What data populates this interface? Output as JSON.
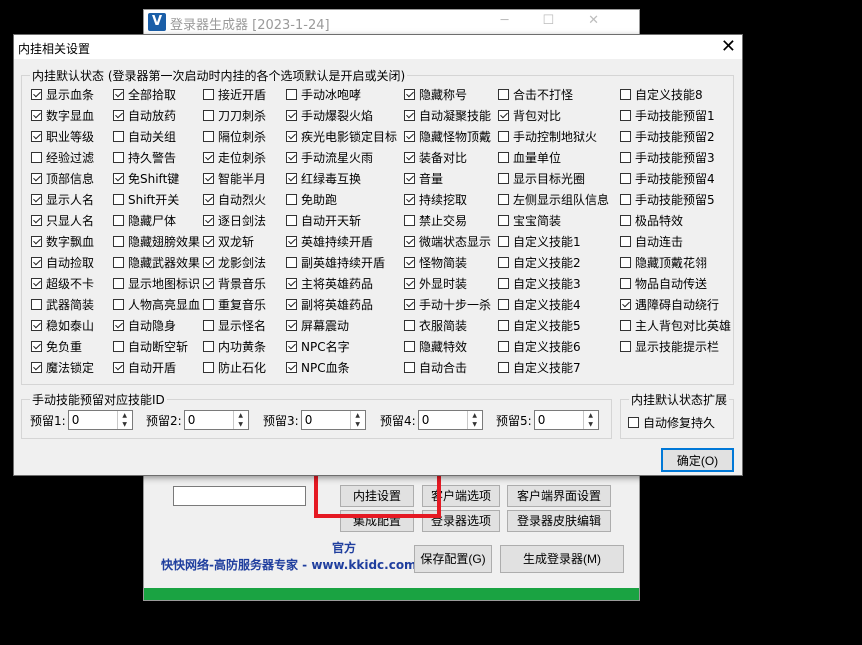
{
  "main_window": {
    "title": "登录器生成器 [2023-1-24]",
    "app_icon_letter": "V",
    "buttons": {
      "plugin_settings": "内挂设置",
      "client_options": "客户端选项",
      "client_ui_settings": "客户端界面设置",
      "collect_config": "集成配置",
      "launcher_options": "登录器选项",
      "launcher_skin": "登录器皮肤编辑",
      "save_config": "保存配置(G)",
      "generate": "生成登录器(M)"
    },
    "official_label": "官方",
    "website": "快快网络-高防服务器专家 - www.kkidc.com"
  },
  "dialog": {
    "title": "内挂相关设置",
    "close_glyph": "✕",
    "defaults_group": "内挂默认状态 (登录器第一次启动时内挂的各个选项默认是开启或关闭)",
    "columns": [
      [
        {
          "label": "显示血条",
          "checked": true
        },
        {
          "label": "数字显血",
          "checked": true
        },
        {
          "label": "职业等级",
          "checked": true
        },
        {
          "label": "经验过滤",
          "checked": false
        },
        {
          "label": "顶部信息",
          "checked": true
        },
        {
          "label": "显示人名",
          "checked": true
        },
        {
          "label": "只显人名",
          "checked": true
        },
        {
          "label": "数字飘血",
          "checked": true
        },
        {
          "label": "自动捡取",
          "checked": true
        },
        {
          "label": "超级不卡",
          "checked": true
        },
        {
          "label": "武器简装",
          "checked": false
        },
        {
          "label": "稳如泰山",
          "checked": true
        },
        {
          "label": "免负重",
          "checked": true
        },
        {
          "label": "魔法锁定",
          "checked": true
        }
      ],
      [
        {
          "label": "全部拾取",
          "checked": true
        },
        {
          "label": "自动放药",
          "checked": true
        },
        {
          "label": "自动关组",
          "checked": false
        },
        {
          "label": "持久警告",
          "checked": false
        },
        {
          "label": "免Shift键",
          "checked": true
        },
        {
          "label": "Shift开关",
          "checked": false
        },
        {
          "label": "隐藏尸体",
          "checked": false
        },
        {
          "label": "隐藏翅膀效果",
          "checked": false
        },
        {
          "label": "隐藏武器效果",
          "checked": false
        },
        {
          "label": "显示地图标识",
          "checked": false
        },
        {
          "label": "人物高亮显血",
          "checked": false
        },
        {
          "label": "自动隐身",
          "checked": true
        },
        {
          "label": "自动断空斩",
          "checked": false
        },
        {
          "label": "自动开盾",
          "checked": true
        }
      ],
      [
        {
          "label": "接近开盾",
          "checked": false
        },
        {
          "label": "刀刀刺杀",
          "checked": false
        },
        {
          "label": "隔位刺杀",
          "checked": false
        },
        {
          "label": "走位刺杀",
          "checked": true
        },
        {
          "label": "智能半月",
          "checked": true
        },
        {
          "label": "自动烈火",
          "checked": true
        },
        {
          "label": "逐日剑法",
          "checked": true
        },
        {
          "label": "双龙斩",
          "checked": true
        },
        {
          "label": "龙影剑法",
          "checked": true
        },
        {
          "label": "背景音乐",
          "checked": true
        },
        {
          "label": "重复音乐",
          "checked": false
        },
        {
          "label": "显示怪名",
          "checked": false
        },
        {
          "label": "内功黄条",
          "checked": false
        },
        {
          "label": "防止石化",
          "checked": false
        }
      ],
      [
        {
          "label": "手动冰咆哮",
          "checked": false
        },
        {
          "label": "手动爆裂火焰",
          "checked": true
        },
        {
          "label": "疾光电影锁定目标",
          "checked": true
        },
        {
          "label": "手动流星火雨",
          "checked": true
        },
        {
          "label": "红绿毒互换",
          "checked": true
        },
        {
          "label": "免助跑",
          "checked": false
        },
        {
          "label": "自动开天斩",
          "checked": false
        },
        {
          "label": "英雄持续开盾",
          "checked": true
        },
        {
          "label": "副英雄持续开盾",
          "checked": false
        },
        {
          "label": "主将英雄药品",
          "checked": true
        },
        {
          "label": "副将英雄药品",
          "checked": true
        },
        {
          "label": "屏幕震动",
          "checked": true
        },
        {
          "label": "NPC名字",
          "checked": true
        },
        {
          "label": "NPC血条",
          "checked": true
        }
      ],
      [
        {
          "label": "隐藏称号",
          "checked": true
        },
        {
          "label": "自动凝聚技能",
          "checked": true
        },
        {
          "label": "隐藏怪物顶戴",
          "checked": true
        },
        {
          "label": "装备对比",
          "checked": true
        },
        {
          "label": "音量",
          "checked": true
        },
        {
          "label": "持续挖取",
          "checked": true
        },
        {
          "label": "禁止交易",
          "checked": false
        },
        {
          "label": "微端状态显示",
          "checked": true
        },
        {
          "label": "怪物简装",
          "checked": true
        },
        {
          "label": "外显时装",
          "checked": true
        },
        {
          "label": "手动十步一杀",
          "checked": true
        },
        {
          "label": "衣服简装",
          "checked": false
        },
        {
          "label": "隐藏特效",
          "checked": false
        },
        {
          "label": "自动合击",
          "checked": false
        }
      ],
      [
        {
          "label": "合击不打怪",
          "checked": false
        },
        {
          "label": "背包对比",
          "checked": true
        },
        {
          "label": "手动控制地狱火",
          "checked": false
        },
        {
          "label": "血量单位",
          "checked": false
        },
        {
          "label": "显示目标光圈",
          "checked": false
        },
        {
          "label": "左侧显示组队信息",
          "checked": false
        },
        {
          "label": "宝宝简装",
          "checked": false
        },
        {
          "label": "自定义技能1",
          "checked": false
        },
        {
          "label": "自定义技能2",
          "checked": false
        },
        {
          "label": "自定义技能3",
          "checked": false
        },
        {
          "label": "自定义技能4",
          "checked": false
        },
        {
          "label": "自定义技能5",
          "checked": false
        },
        {
          "label": "自定义技能6",
          "checked": false
        },
        {
          "label": "自定义技能7",
          "checked": false
        }
      ],
      [
        {
          "label": "自定义技能8",
          "checked": false
        },
        {
          "label": "手动技能预留1",
          "checked": false
        },
        {
          "label": "手动技能预留2",
          "checked": false
        },
        {
          "label": "手动技能预留3",
          "checked": false
        },
        {
          "label": "手动技能预留4",
          "checked": false
        },
        {
          "label": "手动技能预留5",
          "checked": false
        },
        {
          "label": "极品特效",
          "checked": false
        },
        {
          "label": "自动连击",
          "checked": false
        },
        {
          "label": "隐藏顶戴花翎",
          "checked": false
        },
        {
          "label": "物品自动传送",
          "checked": false
        },
        {
          "label": "遇障碍自动绕行",
          "checked": true
        },
        {
          "label": "主人背包对比英雄",
          "checked": false
        },
        {
          "label": "显示技能提示栏",
          "checked": false
        }
      ]
    ],
    "skill_id_group": "手动技能预留对应技能ID",
    "skill_fields": [
      {
        "label": "预留1:",
        "value": "0"
      },
      {
        "label": "预留2:",
        "value": "0"
      },
      {
        "label": "预留3:",
        "value": "0"
      },
      {
        "label": "预留4:",
        "value": "0"
      },
      {
        "label": "预留5:",
        "value": "0"
      }
    ],
    "extension_group": "内挂默认状态扩展",
    "extension_option": {
      "label": "自动修复持久",
      "checked": false
    },
    "ok_button": "确定(O)"
  }
}
